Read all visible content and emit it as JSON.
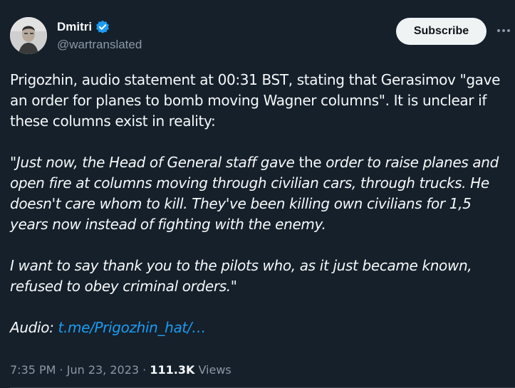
{
  "author": {
    "display_name": "Dmitri",
    "handle": "@wartranslated",
    "verified": true
  },
  "actions": {
    "subscribe_label": "Subscribe",
    "more_icon": "more-horizontal-icon"
  },
  "tweet": {
    "paragraph1": "Prigozhin, audio statement at 00:31 BST, stating that Gerasimov \"gave an order for planes to bomb moving Wagner columns\". It is unclear if these columns exist in reality:",
    "quote1_part1": "\"Just now, the Head of General staff gave ",
    "quote1_upright": "the",
    "quote1_part2": " order to raise planes and open fire at columns moving through civilian cars, through trucks. He doesn't care whom to kill. They've been killing own civilians for 1,5 years now instead of fighting with the enemy.",
    "quote2": "I want to say thank you to the pilots who, as it just became known, refused to obey criminal orders.\"",
    "audio_label": "Audio: ",
    "audio_link": "t.me/Prigozhin_hat/…"
  },
  "meta": {
    "time": "7:35 PM",
    "separator1": " · ",
    "date": "Jun 23, 2023",
    "separator2": " · ",
    "views_count": "111.3K",
    "views_label": " Views"
  },
  "colors": {
    "background": "#15202b",
    "text": "#f7f9f9",
    "secondary": "#8b98a5",
    "link": "#1d9bf0",
    "verified": "#1d9bf0",
    "button_bg": "#eff3f4"
  }
}
